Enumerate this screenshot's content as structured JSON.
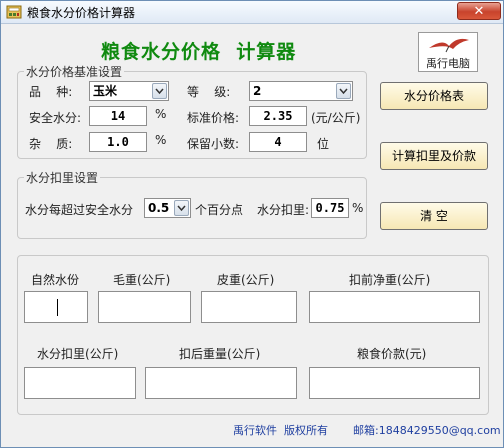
{
  "window": {
    "title": "粮食水分价格计算器",
    "close_label": "✕"
  },
  "heading": "粮食水分价格  计算器",
  "logo": {
    "text": "禹行电脑"
  },
  "base_group": {
    "title": "水分价格基准设置",
    "variety_label": "品    种:",
    "variety_value": "玉米",
    "grade_label": "等    级:",
    "grade_value": "2",
    "safe_moisture_label": "安全水分:",
    "safe_moisture_value": "14",
    "safe_moisture_unit": "%",
    "std_price_label": "标准价格:",
    "std_price_value": "2.35",
    "std_price_unit": "(元/公斤)",
    "impurity_label": "杂    质:",
    "impurity_value": "1.0",
    "impurity_unit": "%",
    "decimals_label": "保留小数:",
    "decimals_value": "4",
    "decimals_unit": "位"
  },
  "deduct_group": {
    "title": "水分扣里设置",
    "exceed_label": "水分每超过安全水分",
    "exceed_value": "0.5",
    "exceed_unit": "个百分点",
    "deduct_label": "水分扣里:",
    "deduct_value": "0.75",
    "deduct_unit": "%"
  },
  "buttons": {
    "price_table": "水分价格表",
    "calculate": "计算扣里及价款",
    "clear": "清    空"
  },
  "calc_group": {
    "natural_moisture": "自然水份",
    "gross_weight": "毛重(公斤)",
    "tare_weight": "皮重(公斤)",
    "net_before": "扣前净重(公斤)",
    "moisture_deduct": "水分扣里(公斤)",
    "weight_after": "扣后重量(公斤)",
    "grain_payment": "粮食价款(元)"
  },
  "footer": {
    "copyright": "禹行软件  版权所有",
    "email": "邮箱:1848429550@qq.com"
  },
  "colors": {
    "heading": "#108a10",
    "footer": "#1f3fa0",
    "button_face": "#f6e7b4"
  }
}
